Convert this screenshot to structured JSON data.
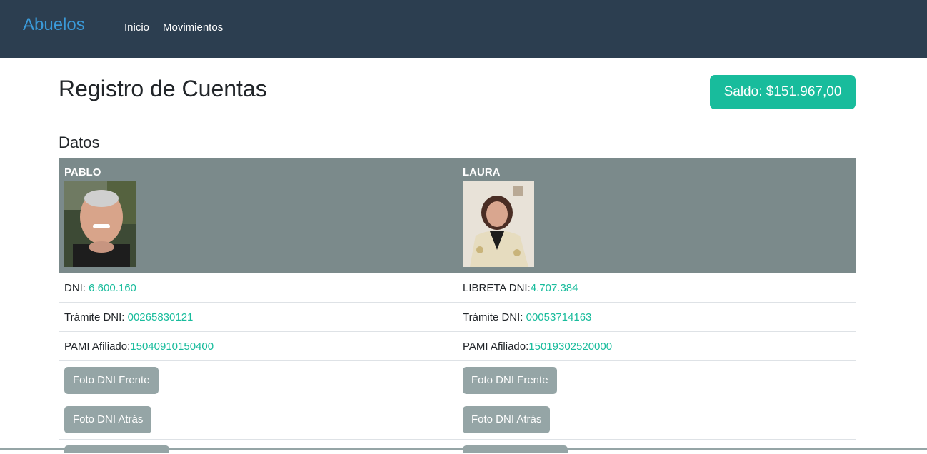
{
  "navbar": {
    "brand": "Abuelos",
    "links": [
      "Inicio",
      "Movimientos"
    ]
  },
  "header": {
    "title": "Registro de Cuentas",
    "saldo": "Saldo: $151.967,00"
  },
  "section": {
    "title": "Datos"
  },
  "people": [
    {
      "name": "PABLO",
      "dni_label": "DNI: ",
      "dni_value": "6.600.160",
      "tramite_label": "Trámite DNI: ",
      "tramite_value": "00265830121",
      "pami_label": "PAMI Afiliado:",
      "pami_value": "15040910150400",
      "btn_frente": "Foto DNI Frente",
      "btn_atras": "Foto DNI Atrás"
    },
    {
      "name": "LAURA",
      "dni_label": "LIBRETA DNI:",
      "dni_value": "4.707.384",
      "tramite_label": "Trámite DNI: ",
      "tramite_value": "00053714163",
      "pami_label": "PAMI Afiliado:",
      "pami_value": "15019302520000",
      "btn_frente": "Foto DNI Frente",
      "btn_atras": "Foto DNI Atrás"
    }
  ],
  "colors": {
    "navbar": "#2c3e50",
    "brand": "#3a9ad9",
    "success": "#18bc9c",
    "table_head": "#7b8a8b",
    "secondary_button": "#95a5a6"
  }
}
